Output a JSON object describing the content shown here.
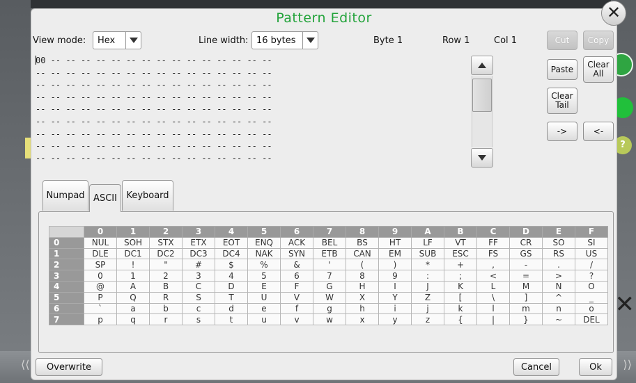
{
  "dialog": {
    "title": "Pattern Editor",
    "close_glyph": "✕"
  },
  "toolbar": {
    "view_mode_label": "View mode:",
    "view_mode_value": "Hex",
    "line_width_label": "Line width:",
    "line_width_value": "16 bytes",
    "byte_status": "Byte 1",
    "row_status": "Row 1",
    "col_status": "Col 1"
  },
  "editor": {
    "first_value": "00",
    "lines": [
      " -- -- -- -- -- -- -- -- -- -- -- -- -- -- --",
      "-- -- -- -- -- -- -- -- -- -- -- -- -- -- -- --",
      "-- -- -- -- -- -- -- -- -- -- -- -- -- -- -- --",
      "-- -- -- -- -- -- -- -- -- -- -- -- -- -- -- --",
      "-- -- -- -- -- -- -- -- -- -- -- -- -- -- -- --",
      "-- -- -- -- -- -- -- -- -- -- -- -- -- -- -- --",
      "-- -- -- -- -- -- -- -- -- -- -- -- -- -- -- --",
      "-- -- -- -- -- -- -- -- -- -- -- -- -- -- -- --",
      "-- -- -- -- -- -- -- -- -- -- -- -- -- -- -- --"
    ]
  },
  "edit_buttons": {
    "cut": "Cut",
    "copy": "Copy",
    "paste": "Paste",
    "clear_all_1": "Clear",
    "clear_all_2": "All",
    "clear_tail_1": "Clear",
    "clear_tail_2": "Tail",
    "right": "->",
    "left": "<-"
  },
  "tabs": [
    "Numpad",
    "ASCII",
    "Keyboard"
  ],
  "ascii_table": {
    "col_headers": [
      "0",
      "1",
      "2",
      "3",
      "4",
      "5",
      "6",
      "7",
      "8",
      "9",
      "A",
      "B",
      "C",
      "D",
      "E",
      "F"
    ],
    "rows": [
      {
        "h": "0",
        "cells": [
          "NUL",
          "SOH",
          "STX",
          "ETX",
          "EOT",
          "ENQ",
          "ACK",
          "BEL",
          "BS",
          "HT",
          "LF",
          "VT",
          "FF",
          "CR",
          "SO",
          "SI"
        ]
      },
      {
        "h": "1",
        "cells": [
          "DLE",
          "DC1",
          "DC2",
          "DC3",
          "DC4",
          "NAK",
          "SYN",
          "ETB",
          "CAN",
          "EM",
          "SUB",
          "ESC",
          "FS",
          "GS",
          "RS",
          "US"
        ]
      },
      {
        "h": "2",
        "cells": [
          "SP",
          "!",
          "\"",
          "#",
          "$",
          "%",
          "&",
          "'",
          "(",
          ")",
          "*",
          "+",
          ",",
          "-",
          ".",
          "/"
        ]
      },
      {
        "h": "3",
        "cells": [
          "0",
          "1",
          "2",
          "3",
          "4",
          "5",
          "6",
          "7",
          "8",
          "9",
          ":",
          ";",
          "<",
          "=",
          ">",
          "?"
        ]
      },
      {
        "h": "4",
        "cells": [
          "@",
          "A",
          "B",
          "C",
          "D",
          "E",
          "F",
          "G",
          "H",
          "I",
          "J",
          "K",
          "L",
          "M",
          "N",
          "O"
        ]
      },
      {
        "h": "5",
        "cells": [
          "P",
          "Q",
          "R",
          "S",
          "T",
          "U",
          "V",
          "W",
          "X",
          "Y",
          "Z",
          "[",
          "\\",
          "]",
          "^",
          "_"
        ]
      },
      {
        "h": "6",
        "cells": [
          "`",
          "a",
          "b",
          "c",
          "d",
          "e",
          "f",
          "g",
          "h",
          "i",
          "j",
          "k",
          "l",
          "m",
          "n",
          "o"
        ]
      },
      {
        "h": "7",
        "cells": [
          "p",
          "q",
          "r",
          "s",
          "t",
          "u",
          "v",
          "w",
          "x",
          "y",
          "z",
          "{",
          "|",
          "}",
          "~",
          "DEL"
        ]
      }
    ]
  },
  "footer": {
    "overwrite": "Overwrite",
    "cancel": "Cancel",
    "ok": "Ok"
  },
  "colors": {
    "title": "#22a33a",
    "header_cell": "#999999"
  }
}
